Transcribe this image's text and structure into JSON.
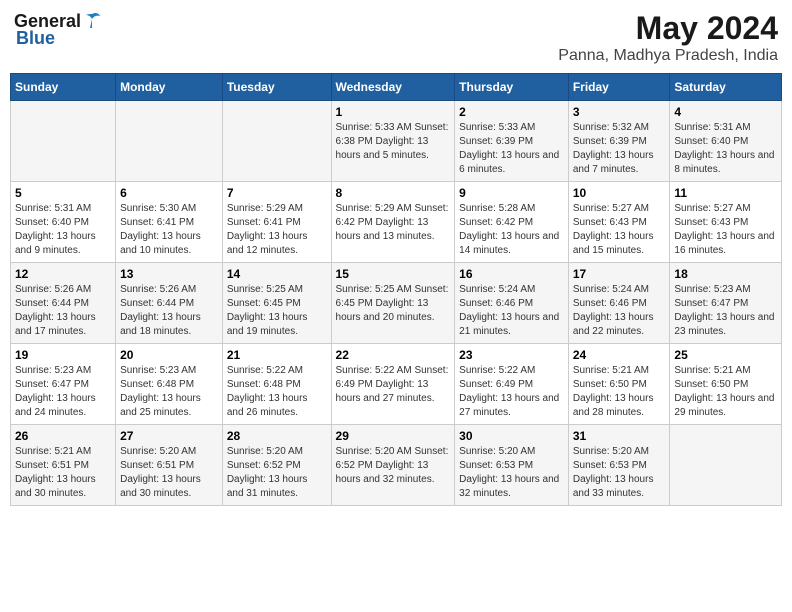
{
  "logo": {
    "general": "General",
    "blue": "Blue"
  },
  "title": "May 2024",
  "subtitle": "Panna, Madhya Pradesh, India",
  "days_of_week": [
    "Sunday",
    "Monday",
    "Tuesday",
    "Wednesday",
    "Thursday",
    "Friday",
    "Saturday"
  ],
  "weeks": [
    [
      {
        "day": "",
        "info": ""
      },
      {
        "day": "",
        "info": ""
      },
      {
        "day": "",
        "info": ""
      },
      {
        "day": "1",
        "info": "Sunrise: 5:33 AM\nSunset: 6:38 PM\nDaylight: 13 hours\nand 5 minutes."
      },
      {
        "day": "2",
        "info": "Sunrise: 5:33 AM\nSunset: 6:39 PM\nDaylight: 13 hours\nand 6 minutes."
      },
      {
        "day": "3",
        "info": "Sunrise: 5:32 AM\nSunset: 6:39 PM\nDaylight: 13 hours\nand 7 minutes."
      },
      {
        "day": "4",
        "info": "Sunrise: 5:31 AM\nSunset: 6:40 PM\nDaylight: 13 hours\nand 8 minutes."
      }
    ],
    [
      {
        "day": "5",
        "info": "Sunrise: 5:31 AM\nSunset: 6:40 PM\nDaylight: 13 hours\nand 9 minutes."
      },
      {
        "day": "6",
        "info": "Sunrise: 5:30 AM\nSunset: 6:41 PM\nDaylight: 13 hours\nand 10 minutes."
      },
      {
        "day": "7",
        "info": "Sunrise: 5:29 AM\nSunset: 6:41 PM\nDaylight: 13 hours\nand 12 minutes."
      },
      {
        "day": "8",
        "info": "Sunrise: 5:29 AM\nSunset: 6:42 PM\nDaylight: 13 hours\nand 13 minutes."
      },
      {
        "day": "9",
        "info": "Sunrise: 5:28 AM\nSunset: 6:42 PM\nDaylight: 13 hours\nand 14 minutes."
      },
      {
        "day": "10",
        "info": "Sunrise: 5:27 AM\nSunset: 6:43 PM\nDaylight: 13 hours\nand 15 minutes."
      },
      {
        "day": "11",
        "info": "Sunrise: 5:27 AM\nSunset: 6:43 PM\nDaylight: 13 hours\nand 16 minutes."
      }
    ],
    [
      {
        "day": "12",
        "info": "Sunrise: 5:26 AM\nSunset: 6:44 PM\nDaylight: 13 hours\nand 17 minutes."
      },
      {
        "day": "13",
        "info": "Sunrise: 5:26 AM\nSunset: 6:44 PM\nDaylight: 13 hours\nand 18 minutes."
      },
      {
        "day": "14",
        "info": "Sunrise: 5:25 AM\nSunset: 6:45 PM\nDaylight: 13 hours\nand 19 minutes."
      },
      {
        "day": "15",
        "info": "Sunrise: 5:25 AM\nSunset: 6:45 PM\nDaylight: 13 hours\nand 20 minutes."
      },
      {
        "day": "16",
        "info": "Sunrise: 5:24 AM\nSunset: 6:46 PM\nDaylight: 13 hours\nand 21 minutes."
      },
      {
        "day": "17",
        "info": "Sunrise: 5:24 AM\nSunset: 6:46 PM\nDaylight: 13 hours\nand 22 minutes."
      },
      {
        "day": "18",
        "info": "Sunrise: 5:23 AM\nSunset: 6:47 PM\nDaylight: 13 hours\nand 23 minutes."
      }
    ],
    [
      {
        "day": "19",
        "info": "Sunrise: 5:23 AM\nSunset: 6:47 PM\nDaylight: 13 hours\nand 24 minutes."
      },
      {
        "day": "20",
        "info": "Sunrise: 5:23 AM\nSunset: 6:48 PM\nDaylight: 13 hours\nand 25 minutes."
      },
      {
        "day": "21",
        "info": "Sunrise: 5:22 AM\nSunset: 6:48 PM\nDaylight: 13 hours\nand 26 minutes."
      },
      {
        "day": "22",
        "info": "Sunrise: 5:22 AM\nSunset: 6:49 PM\nDaylight: 13 hours\nand 27 minutes."
      },
      {
        "day": "23",
        "info": "Sunrise: 5:22 AM\nSunset: 6:49 PM\nDaylight: 13 hours\nand 27 minutes."
      },
      {
        "day": "24",
        "info": "Sunrise: 5:21 AM\nSunset: 6:50 PM\nDaylight: 13 hours\nand 28 minutes."
      },
      {
        "day": "25",
        "info": "Sunrise: 5:21 AM\nSunset: 6:50 PM\nDaylight: 13 hours\nand 29 minutes."
      }
    ],
    [
      {
        "day": "26",
        "info": "Sunrise: 5:21 AM\nSunset: 6:51 PM\nDaylight: 13 hours\nand 30 minutes."
      },
      {
        "day": "27",
        "info": "Sunrise: 5:20 AM\nSunset: 6:51 PM\nDaylight: 13 hours\nand 30 minutes."
      },
      {
        "day": "28",
        "info": "Sunrise: 5:20 AM\nSunset: 6:52 PM\nDaylight: 13 hours\nand 31 minutes."
      },
      {
        "day": "29",
        "info": "Sunrise: 5:20 AM\nSunset: 6:52 PM\nDaylight: 13 hours\nand 32 minutes."
      },
      {
        "day": "30",
        "info": "Sunrise: 5:20 AM\nSunset: 6:53 PM\nDaylight: 13 hours\nand 32 minutes."
      },
      {
        "day": "31",
        "info": "Sunrise: 5:20 AM\nSunset: 6:53 PM\nDaylight: 13 hours\nand 33 minutes."
      },
      {
        "day": "",
        "info": ""
      }
    ]
  ]
}
